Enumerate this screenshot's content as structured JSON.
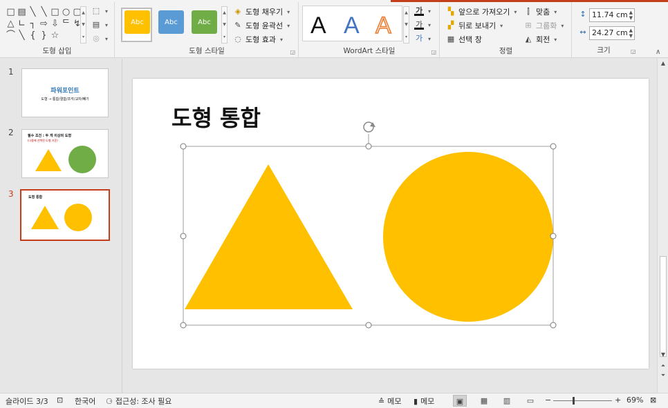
{
  "ribbon": {
    "accent_color": "#c43e1c",
    "groups": {
      "insert_shapes": {
        "label": "도형 삽입",
        "shape_icons": [
          "□",
          "▤",
          "╲",
          "╲",
          "□",
          "○",
          "▢",
          "△",
          "∟",
          "┐",
          "⇨",
          "⇩",
          "ᄃ",
          "↯",
          "⌒",
          "╲",
          "{",
          "}",
          "☆"
        ]
      },
      "shape_styles": {
        "label": "도형 스타일",
        "swatches": [
          {
            "label": "Abc",
            "color": "#ffc000"
          },
          {
            "label": "Abc",
            "color": "#5b9bd5"
          },
          {
            "label": "Abc",
            "color": "#70ad47"
          }
        ],
        "fill_label": "도형 채우기",
        "outline_label": "도형 윤곽선",
        "effects_label": "도형 효과"
      },
      "wordart_styles": {
        "label": "WordArt 스타일",
        "letters": [
          "A",
          "A",
          "A"
        ],
        "text_fill_glyph": "가",
        "text_outline_glyph": "가",
        "text_effects_glyph": "가"
      },
      "arrange": {
        "label": "정렬",
        "bring_forward_label": "앞으로 가져오기",
        "send_backward_label": "뒤로 보내기",
        "selection_pane_label": "선택 창",
        "align_label": "맞춤",
        "group_label": "그룹화",
        "rotate_label": "회전"
      },
      "size": {
        "label": "크기",
        "height_value": "11.74 cm",
        "width_value": "24.27 cm"
      }
    }
  },
  "thumbnails": [
    {
      "number": "1",
      "title": "파워포인트",
      "subtitle": "도형 → 통합/결합/조각/교차/빼기"
    },
    {
      "number": "2",
      "title": "필수 조건 : 두 개 이상의 도형",
      "subtitle": "(나중에 선택된 도형 기준)"
    },
    {
      "number": "3",
      "title": "도형 통합"
    }
  ],
  "slide": {
    "title": "도형 통합",
    "shape_color": "#ffc000"
  },
  "statusbar": {
    "slide_info": "슬라이드 3/3",
    "language": "한국어",
    "accessibility": "접근성: 조사 필요",
    "notes_label": "메모",
    "comments_label": "메모",
    "zoom_label": "69%"
  }
}
